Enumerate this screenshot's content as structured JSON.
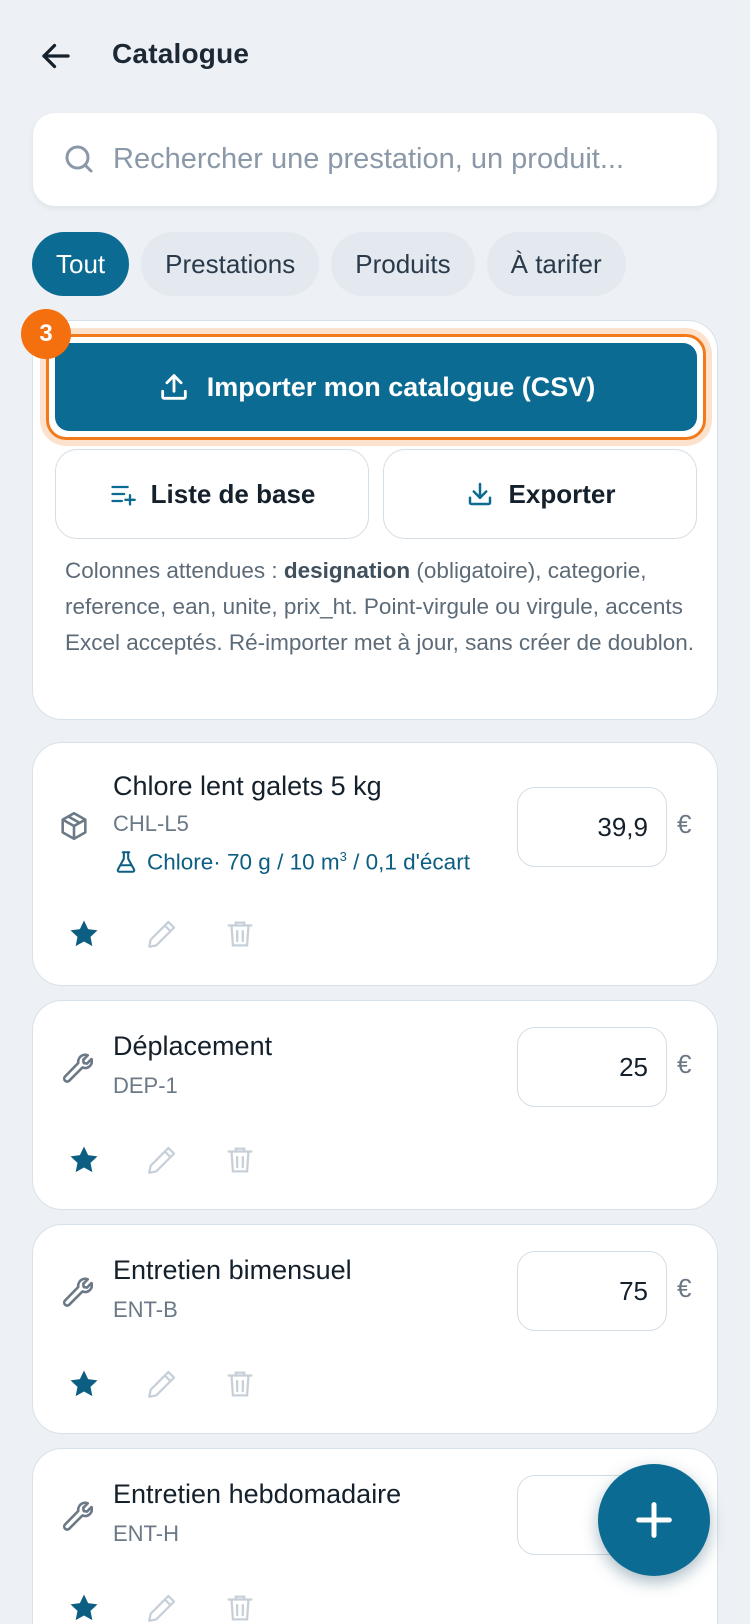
{
  "header": {
    "title": "Catalogue"
  },
  "search": {
    "placeholder": "Rechercher une prestation, un produit..."
  },
  "filters": [
    {
      "label": "Tout",
      "active": true
    },
    {
      "label": "Prestations",
      "active": false
    },
    {
      "label": "Produits",
      "active": false
    },
    {
      "label": "À tarifer",
      "active": false
    }
  ],
  "import_card": {
    "step_badge": "3",
    "import_label": "Importer mon catalogue (CSV)",
    "base_list_label": "Liste de base",
    "export_label": "Exporter",
    "help_prefix": "Colonnes attendues : ",
    "help_bold": "designation",
    "help_suffix": " (obligatoire), categorie, reference, ean, unite, prix_ht. Point-virgule ou virgule, accents Excel acceptés. Ré-importer met à jour, sans créer de doublon."
  },
  "items": [
    {
      "name": "Chlore lent galets 5 kg",
      "ref": "CHL-L5",
      "chem_label": "Chlore",
      "chem_detail": "· 70 g / 10 m",
      "chem_sup": "3",
      "chem_tail": " / 0,1 d'écart",
      "price": "39,9",
      "currency": "€",
      "icon": "package-icon"
    },
    {
      "name": "Déplacement",
      "ref": "DEP-1",
      "price": "25",
      "currency": "€",
      "icon": "wrench-icon"
    },
    {
      "name": "Entretien bimensuel",
      "ref": "ENT-B",
      "price": "75",
      "currency": "€",
      "icon": "wrench-icon"
    },
    {
      "name": "Entretien hebdomadaire",
      "ref": "ENT-H",
      "price": "",
      "currency": "€",
      "icon": "wrench-icon"
    }
  ],
  "colors": {
    "primary": "#0c6b92",
    "accent": "#f46f0d",
    "background": "#edf1f5"
  }
}
